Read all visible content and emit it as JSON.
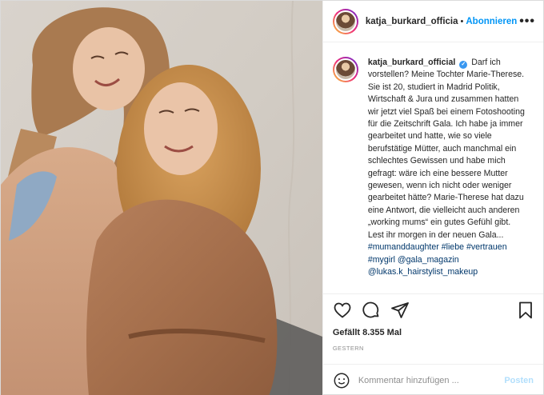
{
  "header": {
    "username": "katja_burkard_officia",
    "separator": "•",
    "follow_label": "Abonnieren",
    "more_label": "•••"
  },
  "caption": {
    "username": "katja_burkard_official",
    "verified_mark": "✓",
    "text": "Darf ich vorstellen? Meine Tochter Marie-Therese. Sie ist 20, studiert in Madrid Politik, Wirtschaft & Jura und zusammen hatten wir jetzt viel Spaß bei einem Fotoshooting für die Zeitschrift Gala. Ich habe ja immer gearbeitet und hatte, wie so viele berufstätige Mütter, auch manchmal ein schlechtes Gewissen und habe mich gefragt: wäre ich eine bessere Mutter gewesen, wenn ich nicht oder weniger gearbeitet hätte? Marie-Therese hat dazu eine Antwort, die vielleicht auch anderen „working mums“ ein gutes Gefühl gibt. Lest ihr morgen in der neuen Gala...",
    "tags": [
      "#mumanddaughter",
      "#liebe",
      "#vertrauen",
      "#mygirl",
      "@gala_magazin",
      "@lukas.k_hairstylist_makeup"
    ]
  },
  "actions": {
    "like_icon": "heart-icon",
    "comment_icon": "comment-icon",
    "share_icon": "share-icon",
    "save_icon": "bookmark-icon"
  },
  "likes": "Gefällt 8.355 Mal",
  "date": "GESTERN",
  "comment_box": {
    "placeholder": "Kommentar hinzufügen ...",
    "post_label": "Posten"
  },
  "colors": {
    "accent": "#0095f6",
    "link": "#00376b",
    "muted": "#8e8e8e"
  }
}
